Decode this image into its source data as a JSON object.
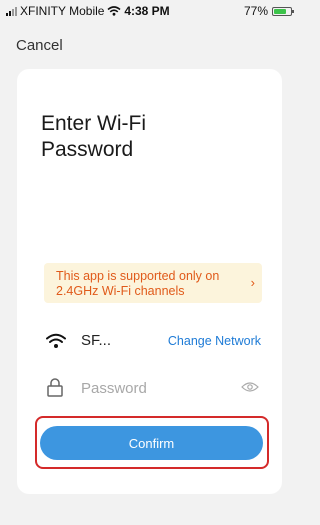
{
  "status_bar": {
    "carrier": "XFINITY Mobile",
    "time": "4:38 PM",
    "battery_text": "77%",
    "battery_level": 0.77
  },
  "nav": {
    "cancel_label": "Cancel"
  },
  "card": {
    "title": "Enter Wi-Fi Password",
    "notice": "This app is supported only on 2.4GHz Wi-Fi channels",
    "notice_arrow": "›",
    "ssid": "SF...",
    "change_network_label": "Change Network",
    "password_placeholder": "Password",
    "confirm_label": "Confirm"
  },
  "colors": {
    "accent": "#3d96e0",
    "link": "#1e7bd6",
    "warning_text": "#e05a1a",
    "warning_bg": "#fcf4dc",
    "highlight": "#d42a2a"
  },
  "icons": [
    "signal-icon",
    "wifi-icon",
    "battery-icon",
    "lock-icon",
    "eye-icon",
    "chevron-right-icon"
  ]
}
